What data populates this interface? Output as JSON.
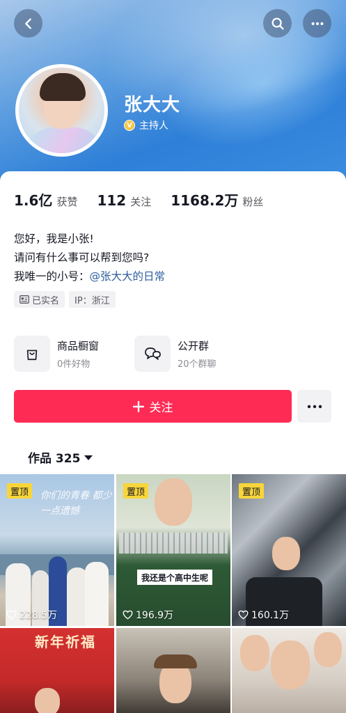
{
  "nav": {
    "back_icon": "chevron-left-icon",
    "search_icon": "search-icon",
    "more_icon": "more-horizontal-icon"
  },
  "profile": {
    "name": "张大大",
    "role": "主持人",
    "verified_badge": "V"
  },
  "stats": [
    {
      "value": "1.6亿",
      "label": "获赞"
    },
    {
      "value": "112",
      "label": "关注"
    },
    {
      "value": "1168.2万",
      "label": "粉丝"
    }
  ],
  "bio": {
    "line1": "您好，我是小张!",
    "line2": "请问有什么事可以帮到您吗?",
    "line3_prefix": "我唯一的小号：",
    "line3_mention": "@张大大的日常"
  },
  "tags": [
    {
      "icon": "id-card-icon",
      "label": "已实名"
    },
    {
      "label": "IP：浙江"
    }
  ],
  "shortcuts": [
    {
      "icon": "shopping-bag-icon",
      "title": "商品橱窗",
      "subtitle": "0件好物"
    },
    {
      "icon": "chat-bubbles-icon",
      "title": "公开群",
      "subtitle": "20个群聊"
    }
  ],
  "actions": {
    "follow_label": "关注",
    "more_icon": "more-horizontal-icon"
  },
  "works": {
    "label": "作品 325"
  },
  "videos": [
    {
      "pinned": "置顶",
      "likes": "228.5万",
      "overlay_text": "你们的青春 都少一点遗憾"
    },
    {
      "pinned": "置顶",
      "likes": "196.9万",
      "overlay_text": "我还是个高中生呢"
    },
    {
      "pinned": "置顶",
      "likes": "160.1万"
    },
    {
      "overlay_text": "新年祈福"
    },
    {},
    {}
  ],
  "colors": {
    "accent": "#fe2c55",
    "pin_badge": "#f8d53a",
    "mention": "#2b5d9c",
    "header_blue": "#2d7fd8"
  }
}
